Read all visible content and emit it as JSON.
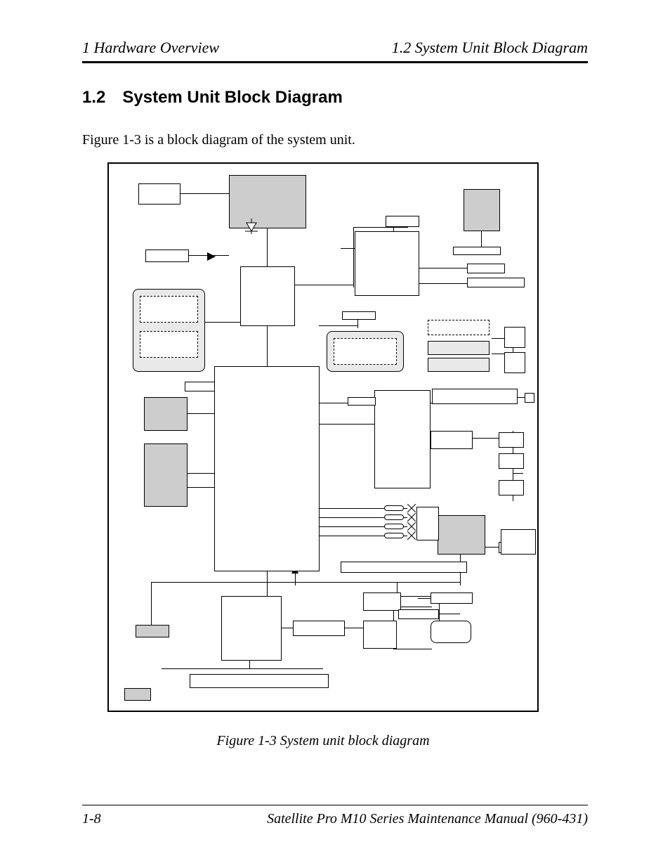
{
  "header": {
    "left": "1  Hardware Overview",
    "right": "1.2  System Unit Block Diagram"
  },
  "section": {
    "number": "1.2",
    "title": "System Unit Block Diagram"
  },
  "intro_text": "Figure 1-3 is a block diagram of the system unit.",
  "figure_caption": "Figure 1-3  System unit block diagram",
  "footer": {
    "page_num": "1-8",
    "manual_title": "Satellite Pro M10 Series Maintenance Manual (960-431)"
  }
}
